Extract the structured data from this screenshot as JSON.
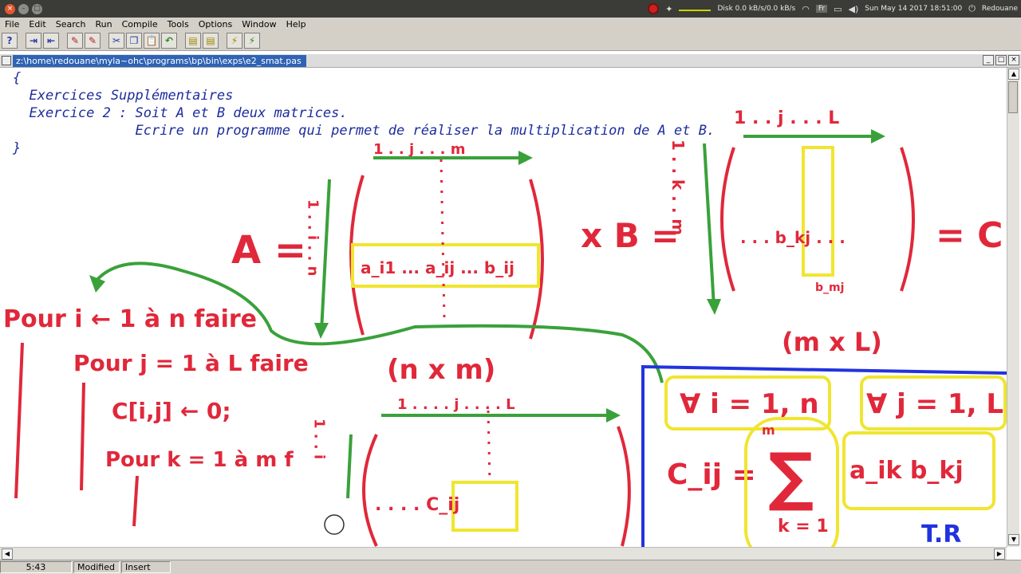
{
  "system_bar": {
    "disk": "Disk 0.0 kB/s/0.0 kB/s",
    "lang": "Fr",
    "datetime": "Sun May 14 2017 18:51:00",
    "user": "Redouane"
  },
  "menu": {
    "items": [
      "File",
      "Edit",
      "Search",
      "Run",
      "Compile",
      "Tools",
      "Options",
      "Window",
      "Help"
    ]
  },
  "editor": {
    "filepath": "z:\\home\\redouane\\myla~ohc\\programs\\bp\\bin\\exps\\e2_smat.pas",
    "code_lines": [
      "{",
      "  Exercices Supplémentaires",
      "  Exercice 2 : Soit A et B deux matrices.",
      "               Ecrire un programme qui permet de réaliser la multiplication de A et B.",
      "}"
    ]
  },
  "annotations": {
    "matrix_a": "A =",
    "a_row": "a_i1 ... a_ij ... b_ij",
    "a_top": "1 . . j . . . m",
    "a_left": "1 . . i . . n",
    "times_b": "x B =",
    "b_top": "1 . . j . . . L",
    "b_left": "1 . . k . . m",
    "b_cell": ". . . b_kj . . .",
    "b_bottom": "b_mj",
    "equals_c": "= C",
    "dim_a": "(n x m)",
    "dim_b": "(m x L)",
    "loop_i": "Pour i ← 1 à n faire",
    "loop_j": "Pour j = 1 à L faire",
    "init": "C[i,j] ← 0;",
    "loop_k": "Pour k = 1 à m f",
    "c_top": "1 . . . . j . . . . L",
    "c_left": "1 . . i",
    "c_cell": ". . . . C_ij",
    "forall_i": "∀ i = 1, n",
    "forall_j": "∀ j = 1, L",
    "formula_lhs": "C_ij =",
    "sum_top": "m",
    "sum_bottom": "k = 1",
    "formula_term": "a_ik  b_kj",
    "tr": "T.R"
  },
  "status": {
    "position": "5:43",
    "modified": "Modified",
    "mode": "Insert"
  }
}
